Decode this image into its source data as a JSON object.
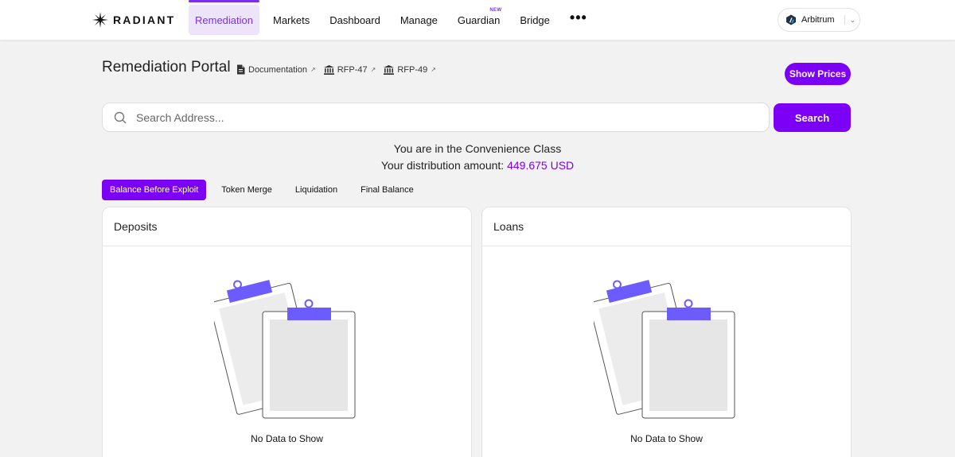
{
  "brand": {
    "name": "RADIANT",
    "accent": "#7b00f5"
  },
  "nav": {
    "items": [
      {
        "label": "Remediation",
        "active": true
      },
      {
        "label": "Markets"
      },
      {
        "label": "Dashboard"
      },
      {
        "label": "Manage"
      },
      {
        "label": "Guardian",
        "badge": "NEW"
      },
      {
        "label": "Bridge"
      }
    ],
    "more": "•••"
  },
  "network": {
    "name": "Arbitrum",
    "icon": "arbitrum-icon"
  },
  "header": {
    "title": "Remediation Portal",
    "links": [
      {
        "label": "Documentation",
        "icon": "document-icon"
      },
      {
        "label": "RFP-47",
        "icon": "bank-icon"
      },
      {
        "label": "RFP-49",
        "icon": "bank-icon"
      }
    ],
    "show_prices": "Show Prices"
  },
  "search": {
    "placeholder": "Search Address...",
    "value": "",
    "button": "Search"
  },
  "class_info": {
    "line1": "You are in the Convenience Class",
    "line2_prefix": "Your distribution amount:",
    "amount": "449.675 USD"
  },
  "tabs": [
    {
      "label": "Balance Before Exploit",
      "active": true
    },
    {
      "label": "Token Merge"
    },
    {
      "label": "Liquidation"
    },
    {
      "label": "Final Balance"
    }
  ],
  "panels": {
    "deposits": {
      "title": "Deposits",
      "empty": "No Data to Show"
    },
    "loans": {
      "title": "Loans",
      "empty": "No Data to Show"
    }
  }
}
